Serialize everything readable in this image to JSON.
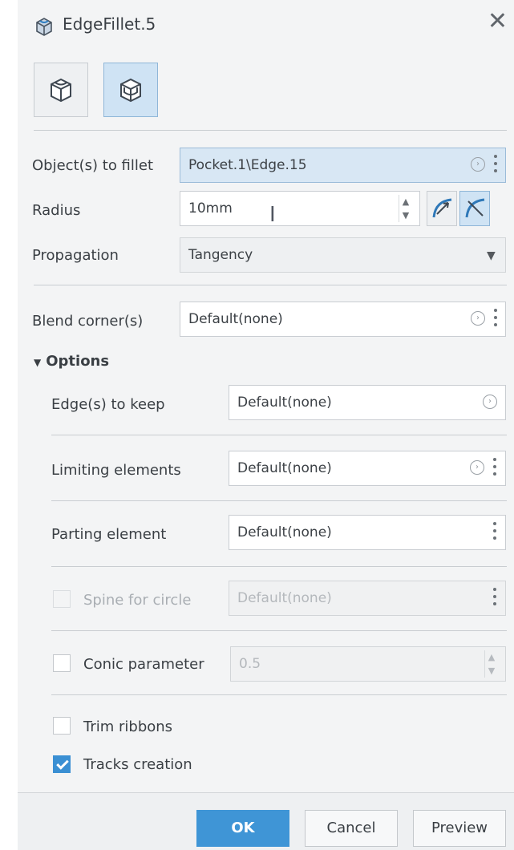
{
  "window": {
    "title": "EdgeFillet.5",
    "close_icon": "close-icon"
  },
  "mode_buttons": [
    {
      "icon": "fillet-mode-icon",
      "active": false
    },
    {
      "icon": "fillet-mode-active-icon",
      "active": true
    }
  ],
  "objects_to_fillet": {
    "label": "Object(s) to fillet",
    "value": "Pocket.1\\Edge.15"
  },
  "radius": {
    "label": "Radius",
    "value": "10mm"
  },
  "propagation": {
    "label": "Propagation",
    "value": "Tangency"
  },
  "blend_corners": {
    "label": "Blend corner(s)",
    "value": "Default(none)"
  },
  "options": {
    "header": "Options",
    "edges_to_keep": {
      "label": "Edge(s) to keep",
      "value": "Default(none)"
    },
    "limiting_elements": {
      "label": "Limiting elements",
      "value": "Default(none)"
    },
    "parting_element": {
      "label": "Parting element",
      "value": "Default(none)"
    },
    "spine_for_circle": {
      "label": "Spine for circle",
      "value": "Default(none)",
      "checked": false,
      "enabled": false
    },
    "conic_parameter": {
      "label": "Conic parameter",
      "value": "0.5",
      "checked": false
    },
    "trim_ribbons": {
      "label": "Trim ribbons",
      "checked": false
    },
    "tracks_creation": {
      "label": "Tracks creation",
      "checked": true
    }
  },
  "buttons": {
    "ok": "OK",
    "cancel": "Cancel",
    "preview": "Preview"
  },
  "colors": {
    "accent": "#3f95d6",
    "selection": "#d8e7f4"
  }
}
